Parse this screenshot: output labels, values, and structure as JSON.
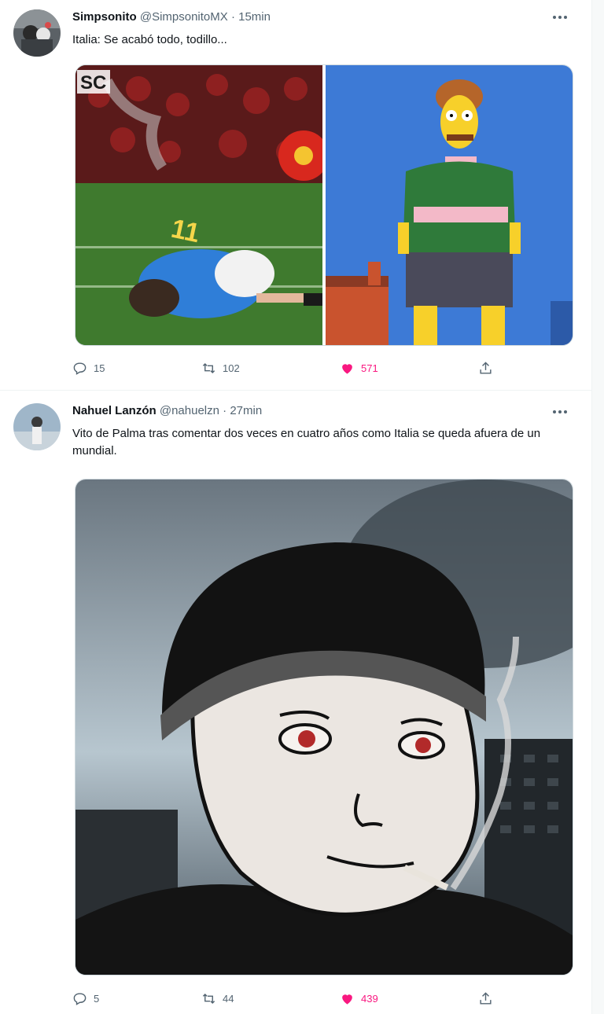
{
  "tweets": [
    {
      "name": "Simpsonito",
      "handle": "@SimpsonitoMX",
      "separator": "·",
      "time": "15min",
      "text": "Italia: Se acabó todo, todillo...",
      "media_badge": "SC",
      "jersey_text": "11",
      "actions": {
        "replies": "15",
        "retweets": "102",
        "likes": "571"
      }
    },
    {
      "name": "Nahuel Lanzón",
      "handle": "@nahuelzn",
      "separator": "·",
      "time": "27min",
      "text": "Vito de Palma tras comentar dos veces en cuatro años como Italia se queda afuera de un mundial.",
      "actions": {
        "replies": "5",
        "retweets": "44",
        "likes": "439"
      }
    }
  ],
  "icons": {
    "reply": "reply-icon",
    "retweet": "retweet-icon",
    "like": "heart-icon",
    "share": "share-icon",
    "more": "more-icon"
  },
  "colors": {
    "like": "#f91880",
    "muted": "#536471"
  }
}
